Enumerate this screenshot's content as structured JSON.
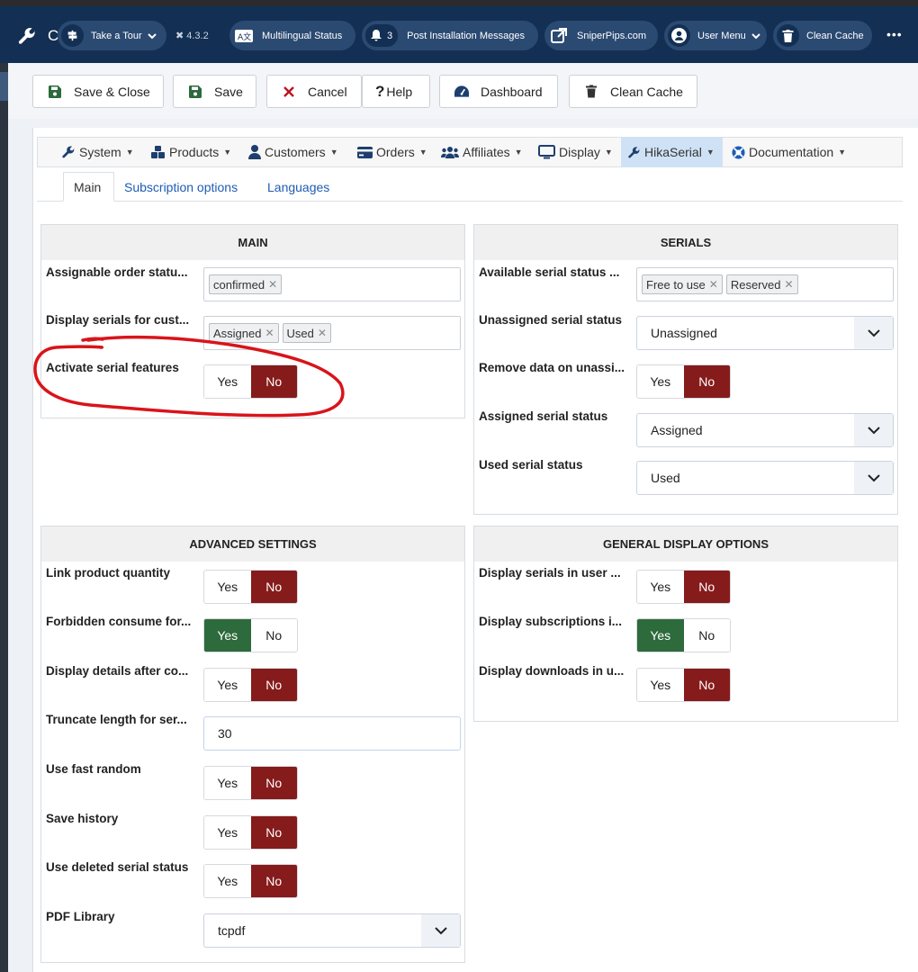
{
  "topbar": {
    "initial": "C",
    "take_tour": "Take a Tour",
    "version": "4.3.2",
    "multilingual": "Multilingual Status",
    "post_install_count": "3",
    "post_install": "Post Installation Messages",
    "site": "SniperPips.com",
    "user_menu": "User Menu",
    "clean_cache": "Clean Cache",
    "more": "•••"
  },
  "toolbar": {
    "save_close": "Save & Close",
    "save": "Save",
    "cancel": "Cancel",
    "help": "Help",
    "dashboard": "Dashboard",
    "clean_cache": "Clean Cache"
  },
  "menu": {
    "system": "System",
    "products": "Products",
    "customers": "Customers",
    "orders": "Orders",
    "affiliates": "Affiliates",
    "display": "Display",
    "hikaserial": "HikaSerial",
    "documentation": "Documentation"
  },
  "tabs": {
    "main": "Main",
    "subscription": "Subscription options",
    "languages": "Languages"
  },
  "toggle": {
    "yes": "Yes",
    "no": "No"
  },
  "main": {
    "title": "MAIN",
    "assignable_label": "Assignable order statu...",
    "assignable_chips": [
      "confirmed"
    ],
    "display_serials_label": "Display serials for cust...",
    "display_serials_chips": [
      "Assigned",
      "Used"
    ],
    "activate_label": "Activate serial features",
    "activate_value": "No"
  },
  "serials": {
    "title": "SERIALS",
    "available_label": "Available serial status ...",
    "available_chips": [
      "Free to use",
      "Reserved"
    ],
    "unassigned_label": "Unassigned serial status",
    "unassigned_value": "Unassigned",
    "remove_label": "Remove data on unassi...",
    "remove_value": "No",
    "assigned_label": "Assigned serial status",
    "assigned_value": "Assigned",
    "used_label": "Used serial status",
    "used_value": "Used"
  },
  "advanced": {
    "title": "ADVANCED SETTINGS",
    "link_qty_label": "Link product quantity",
    "link_qty_value": "No",
    "forbidden_label": "Forbidden consume for...",
    "forbidden_value": "Yes",
    "display_details_label": "Display details after co...",
    "display_details_value": "No",
    "truncate_label": "Truncate length for ser...",
    "truncate_value": "30",
    "fast_random_label": "Use fast random",
    "fast_random_value": "No",
    "save_history_label": "Save history",
    "save_history_value": "No",
    "deleted_status_label": "Use deleted serial status",
    "deleted_status_value": "No",
    "pdf_label": "PDF Library",
    "pdf_value": "tcpdf"
  },
  "general": {
    "title": "GENERAL DISPLAY OPTIONS",
    "serials_user_label": "Display serials in user ...",
    "serials_user_value": "No",
    "subscriptions_label": "Display subscriptions i...",
    "subscriptions_value": "Yes",
    "downloads_label": "Display downloads in u...",
    "downloads_value": "No"
  },
  "colors": {
    "topbar": "#132f53",
    "toggle_no": "#861b1b",
    "toggle_yes": "#2d6a3c",
    "link": "#1f5cb4",
    "annotation": "#d9141a"
  }
}
